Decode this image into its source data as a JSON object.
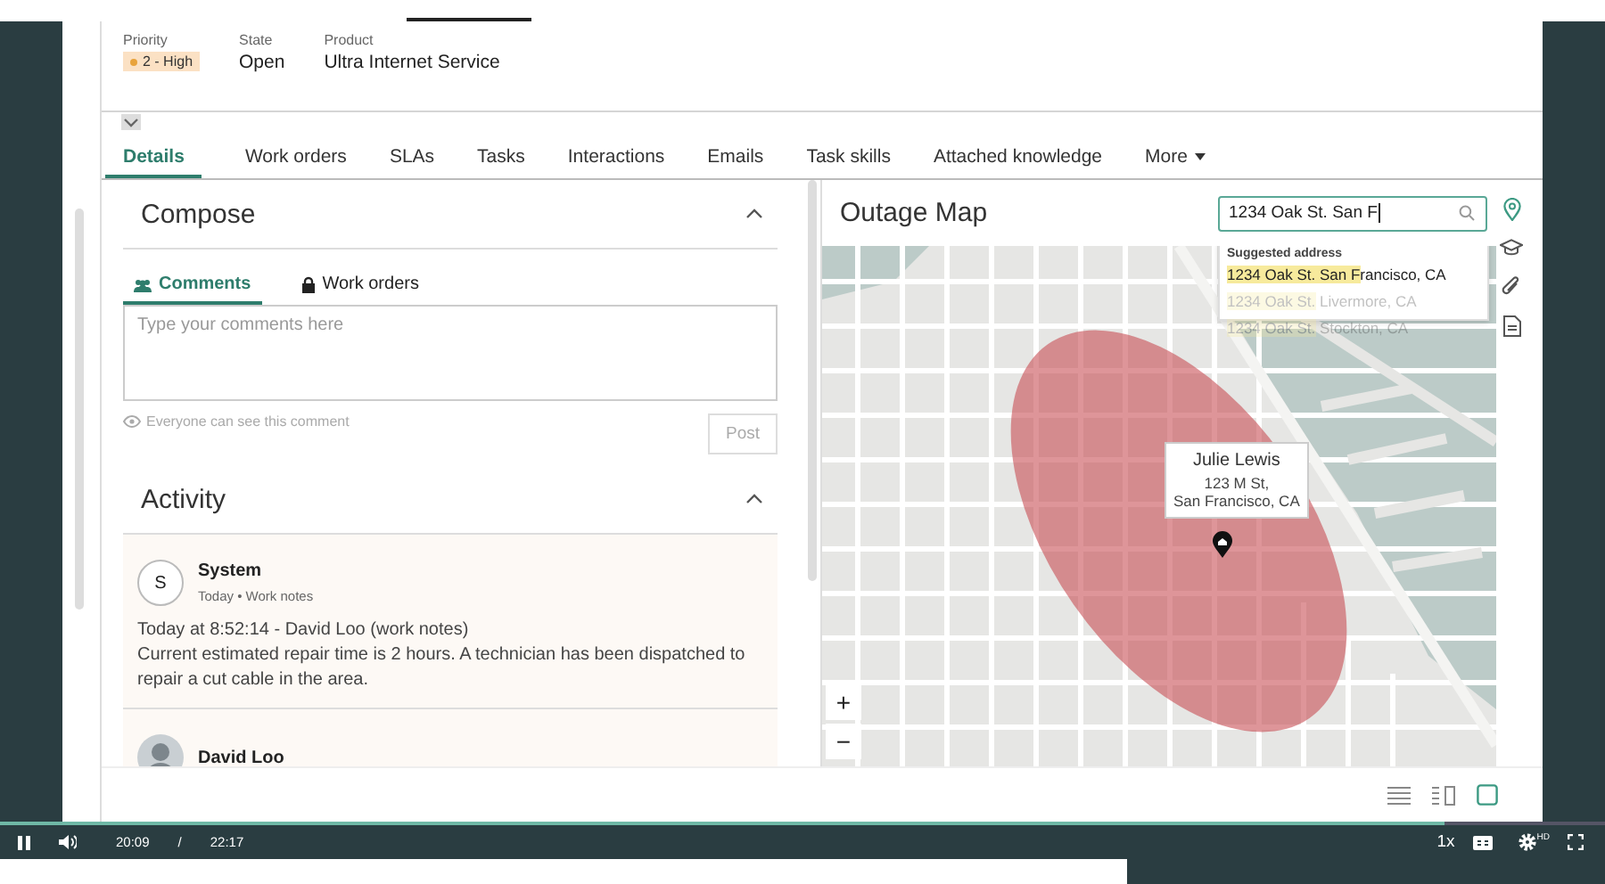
{
  "record": {
    "fields": [
      {
        "label": "Priority",
        "value": "2 - High",
        "kind": "badge",
        "color": "#e8a33c"
      },
      {
        "label": "State",
        "value": "Open",
        "kind": "text"
      },
      {
        "label": "Product",
        "value": "Ultra Internet Service",
        "kind": "text"
      }
    ]
  },
  "tabs": [
    {
      "label": "Details",
      "selected": true,
      "kind": "tab"
    },
    {
      "label": "Work orders",
      "selected": false,
      "kind": "tab"
    },
    {
      "label": "SLAs",
      "selected": false,
      "kind": "tab"
    },
    {
      "label": "Tasks",
      "selected": false,
      "kind": "tab"
    },
    {
      "label": "Interactions",
      "selected": false,
      "kind": "tab"
    },
    {
      "label": "Emails",
      "selected": false,
      "kind": "tab"
    },
    {
      "label": "Task skills",
      "selected": false,
      "kind": "tab"
    },
    {
      "label": "Attached knowledge",
      "selected": false,
      "kind": "tab"
    },
    {
      "label": "More",
      "selected": false,
      "kind": "menu"
    }
  ],
  "compose": {
    "title": "Compose",
    "expanded": true,
    "tabs": [
      {
        "label": "Comments",
        "selected": true,
        "kind": "people"
      },
      {
        "label": "Work orders",
        "selected": false,
        "kind": "lock"
      }
    ],
    "placeholder": "Type your comments here",
    "hint": "Everyone can see this comment",
    "post_button": "Post",
    "post_disabled": true
  },
  "activity": {
    "title": "Activity",
    "expanded": true,
    "entries": [
      {
        "author": "System",
        "kind": "initial",
        "initial": "S",
        "date": "Today",
        "separator": "•",
        "type": "Work notes",
        "heading": "Today at 8:52:14 - David Loo (work notes)",
        "body": "Current estimated repair time is 2 hours. A technician has been dispatched to repair a cut cable in the area."
      },
      {
        "author": "David Loo"
      }
    ]
  },
  "map": {
    "title": "Outage Map",
    "search": {
      "value": "1234 Oak St. San F"
    },
    "suggestions": {
      "heading": "Suggested address",
      "items": [
        {
          "match": "1234 Oak St. San F",
          "rest": "rancisco, CA",
          "faded": false
        },
        {
          "match": "1234 Oak St.",
          "rest": " Livermore, CA",
          "faded": true
        },
        {
          "match": "1234 Oak St.",
          "rest": " Stockton, CA",
          "faded": true
        }
      ]
    },
    "popup": {
      "name": "Julie Lewis",
      "lines": [
        "123 M St,",
        "San Francisco, CA"
      ]
    },
    "zoom": [
      "+",
      "−"
    ]
  },
  "view_modes": [
    {
      "kind": "list",
      "selected": false
    },
    {
      "kind": "split",
      "selected": false
    },
    {
      "kind": "single",
      "selected": true
    }
  ],
  "player": {
    "playing": true,
    "level": 0.9,
    "elapsed": "20:09",
    "separator": "/",
    "duration": "22:17",
    "speed": "1x",
    "quality": "HD"
  }
}
